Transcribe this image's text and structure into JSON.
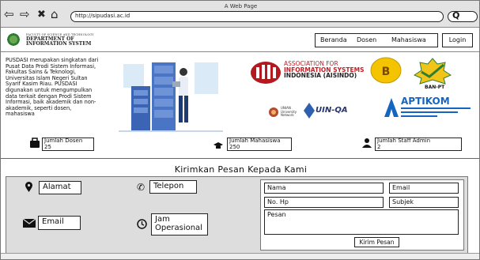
{
  "window": {
    "title": "A Web Page"
  },
  "browser": {
    "url": "http://sipudasi.ac.id",
    "search_glyph": "Q"
  },
  "header": {
    "dept_small": "FACULTY OF SCIENCE AND TECHNOLOGY",
    "dept_line1": "DEPARTMENT OF",
    "dept_line2": "INFORMATION SYSTEM",
    "nav": [
      "Beranda",
      "Dosen",
      "Mahasiswa"
    ],
    "login": "Login"
  },
  "hero": {
    "description": "PUSDASI merupakan singkatan dari Pusat Data Prodi Sistem Informasi, Fakultas Sains & Teknologi, Universitas Islam Negeri Sultan Syarif Kasim Riau. PUSDASI digunakan untuk mengumpulkan data terkait dengan Prodi Sistem Informasi, baik akademik dan non-akademik, seperti dosen, mahasiswa"
  },
  "partners": {
    "aisindo_line1": "ASSOCIATION FOR",
    "aisindo_line2": "INFORMATION SYSTEMS",
    "aisindo_line3": "INDONESIA (AISINDO)",
    "ban_pt": "BAN-PT",
    "ban_grade": "B",
    "uin_network_line1": "UNIAN",
    "uin_network_line2": "University",
    "uin_network_line3": "Network",
    "uinqa": "UIN-QA",
    "aptikom": "APTIKOM"
  },
  "stats": [
    {
      "label": "Jumlah Dosen",
      "value": "25"
    },
    {
      "label": "Jumlah Mahasiswa",
      "value": "250"
    },
    {
      "label": "Jumlah Staff Admin",
      "value": "2"
    }
  ],
  "contact": {
    "title": "Kirimkan Pesan Kepada Kami",
    "alamat": "Alamat",
    "telepon": "Telepon",
    "email": "Email",
    "jam": "Jam Operasional",
    "form": {
      "nama": "Nama",
      "email": "Email",
      "no_hp": "No. Hp",
      "subjek": "Subjek",
      "pesan": "Pesan",
      "submit": "Kirim Pesan"
    }
  }
}
